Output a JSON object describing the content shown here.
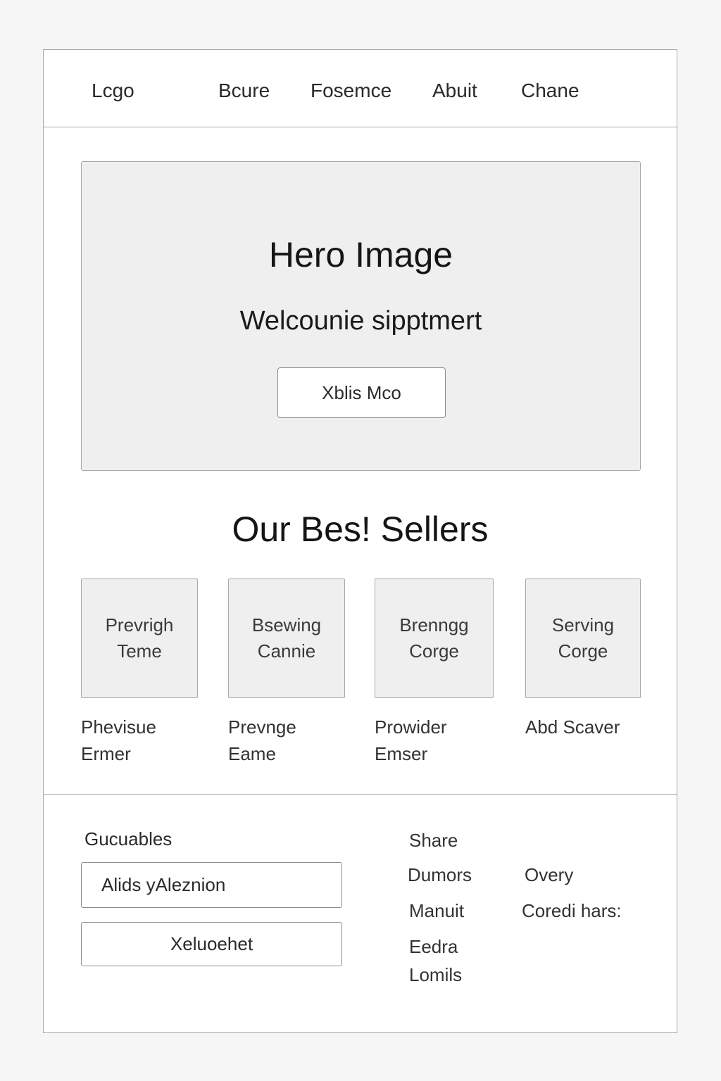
{
  "nav": {
    "logo": "Lcgo",
    "links": [
      "Bcure",
      "Fosemce",
      "Abuit",
      "Chane"
    ]
  },
  "hero": {
    "title": "Hero Image",
    "subtitle": "Welcounie sipptmert",
    "button_label": "Xblis Mco"
  },
  "best_sellers": {
    "title": "Our Bes! Sellers",
    "products": [
      {
        "thumb_line1": "Prevrigh",
        "thumb_line2": "Teme",
        "caption_line1": "Phevisue",
        "caption_line2": "Ermer"
      },
      {
        "thumb_line1": "Bsewing",
        "thumb_line2": "Cannie",
        "caption_line1": "Prevnge",
        "caption_line2": "Eame"
      },
      {
        "thumb_line1": "Brenngg",
        "thumb_line2": "Corge",
        "caption_line1": "Prowider",
        "caption_line2": "Emser"
      },
      {
        "thumb_line1": "Serving",
        "thumb_line2": "Corge",
        "caption_line1": "Abd Scaver",
        "caption_line2": ""
      }
    ]
  },
  "footer": {
    "newsletter_heading": "Gucuables",
    "input_value": "Alids yAleznion",
    "button_label": "Xeluoehet",
    "share_label": "Share",
    "links": {
      "col1": [
        "Dumors",
        "Manuit",
        "Eedra",
        "Lomils"
      ],
      "col2": [
        "Overy",
        "Coredi hars:"
      ]
    }
  }
}
